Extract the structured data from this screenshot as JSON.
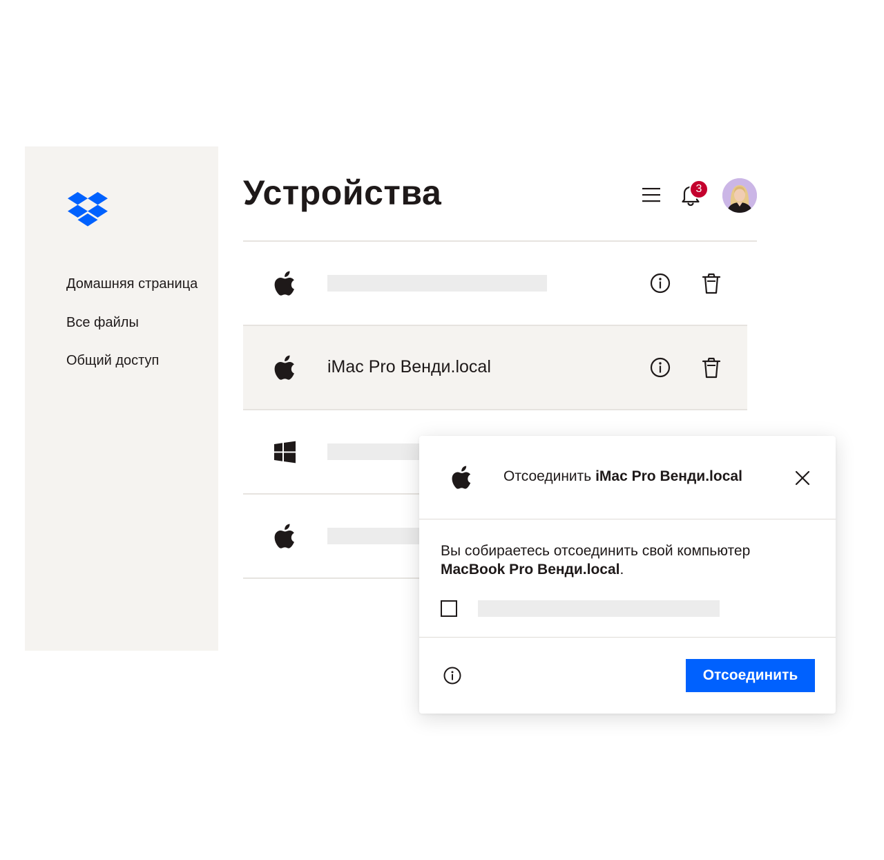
{
  "sidebar": {
    "logo_icon": "dropbox-logo-icon",
    "items": [
      {
        "label": "Домашняя страница"
      },
      {
        "label": "Все файлы"
      },
      {
        "label": "Общий доступ"
      }
    ]
  },
  "header": {
    "title": "Устройства",
    "menu_icon": "hamburger-menu-icon",
    "bell_icon": "bell-icon",
    "notification_count": "3",
    "avatar_icon": "user-avatar"
  },
  "devices": [
    {
      "os_icon": "apple-icon",
      "name": "",
      "selected": false
    },
    {
      "os_icon": "apple-icon",
      "name": "iMac Pro Венди.local",
      "selected": true
    },
    {
      "os_icon": "windows-icon",
      "name": "",
      "selected": false
    },
    {
      "os_icon": "apple-icon",
      "name": "",
      "selected": false
    }
  ],
  "row_actions": {
    "info_icon": "info-icon",
    "delete_icon": "trash-icon"
  },
  "modal": {
    "title_prefix": "Отсоединить",
    "title_device": "iMac Pro Венди.local",
    "body_text": "Вы собираетесь отсоединить свой компьютер",
    "body_device": "MacBook Pro Венди.local",
    "body_suffix": ".",
    "checkbox_checked": false,
    "confirm_label": "Отсоединить"
  },
  "colors": {
    "brand": "#0061fe",
    "sidebar_bg": "#f5f3f0",
    "badge": "#c4012d",
    "text": "#1e1919",
    "placeholder": "#ececec"
  }
}
